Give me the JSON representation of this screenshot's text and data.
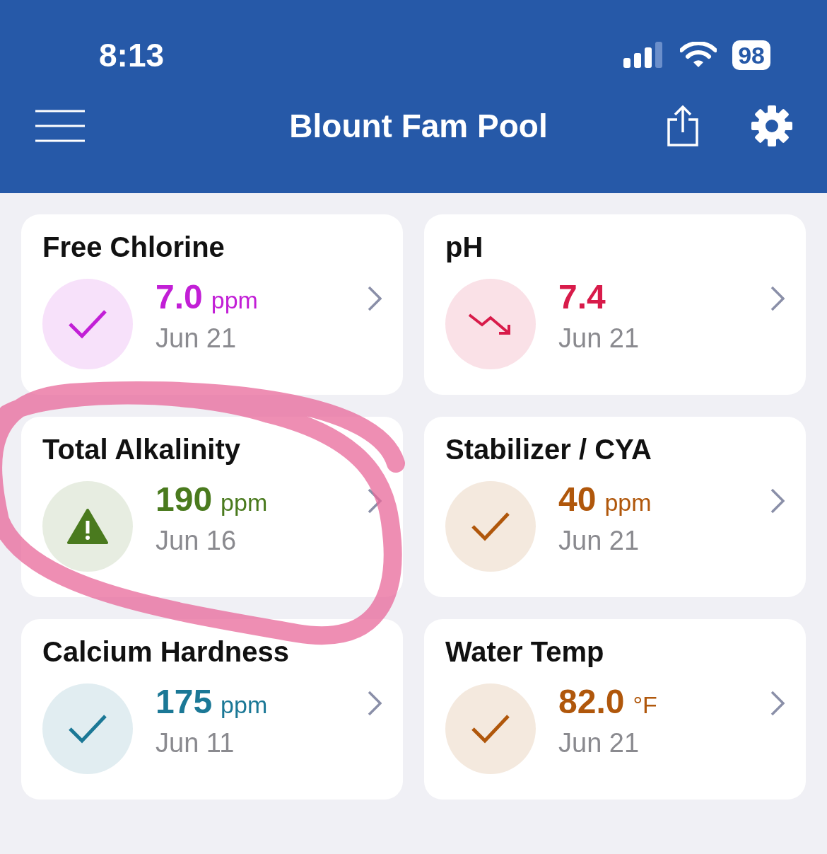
{
  "status_bar": {
    "time": "8:13",
    "battery": "98"
  },
  "header": {
    "title": "Blount Fam Pool"
  },
  "cards": [
    {
      "title": "Free Chlorine",
      "value": "7.0",
      "unit": "ppm",
      "date": "Jun 21",
      "kind": "check",
      "color": "#c21fd6"
    },
    {
      "title": "pH",
      "value": "7.4",
      "date": "Jun 21",
      "kind": "trend-down",
      "color": "#d81b4a"
    },
    {
      "title": "Total Alkalinity",
      "value": "190",
      "unit": "ppm",
      "date": "Jun 16",
      "kind": "warning",
      "color": "#4a7a1e"
    },
    {
      "title": "Stabilizer / CYA",
      "value": "40",
      "unit": "ppm",
      "date": "Jun 21",
      "kind": "check",
      "color": "#b0570b"
    },
    {
      "title": "Calcium Hardness",
      "value": "175",
      "unit": "ppm",
      "date": "Jun 11",
      "kind": "check",
      "color": "#1b7896"
    },
    {
      "title": "Water Temp",
      "value": "82.0",
      "unit": "°F",
      "date": "Jun 21",
      "kind": "check",
      "color": "#b0570b"
    }
  ],
  "annotation": {
    "kind": "circle"
  }
}
